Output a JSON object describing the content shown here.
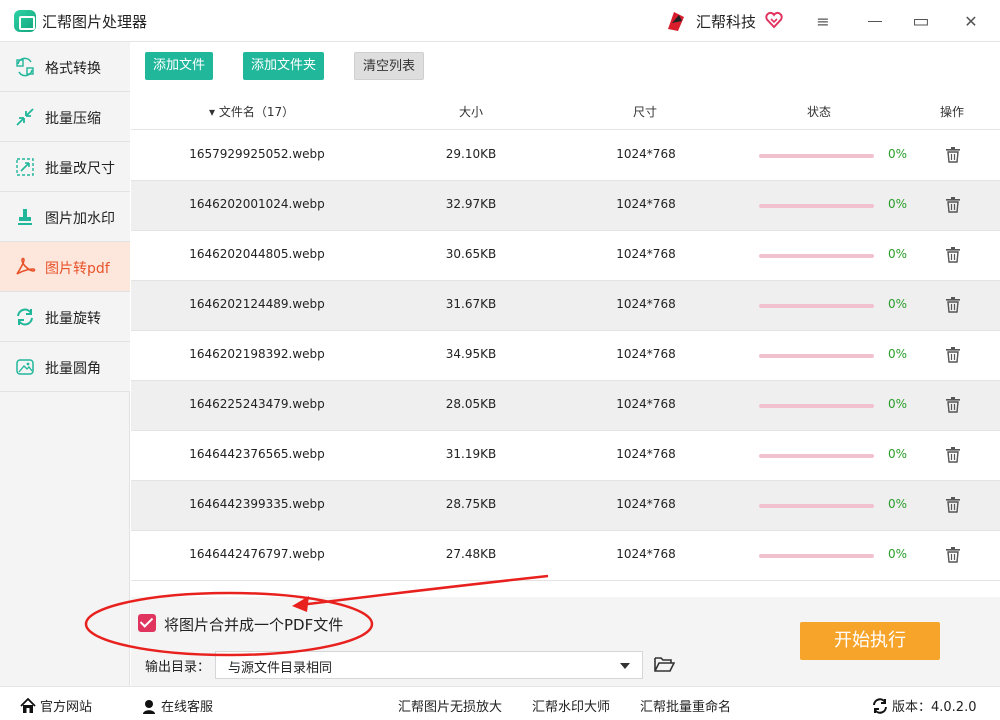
{
  "titlebar": {
    "app_title": "汇帮图片处理器",
    "brand_name": "汇帮科技",
    "menu_glyph": "≡",
    "maximize_glyph": "▭",
    "close_glyph": "✕"
  },
  "sidebar": {
    "items": [
      {
        "label": "格式转换",
        "icon": "format-convert-icon"
      },
      {
        "label": "批量压缩",
        "icon": "compress-icon"
      },
      {
        "label": "批量改尺寸",
        "icon": "resize-icon"
      },
      {
        "label": "图片加水印",
        "icon": "watermark-icon"
      },
      {
        "label": "图片转pdf",
        "icon": "pdf-icon",
        "active": true
      },
      {
        "label": "批量旋转",
        "icon": "rotate-icon"
      },
      {
        "label": "批量圆角",
        "icon": "round-corner-icon"
      }
    ]
  },
  "toolbar": {
    "add_file": "添加文件",
    "add_folder": "添加文件夹",
    "clear_list": "清空列表"
  },
  "table": {
    "headers": {
      "name": "▾ 文件名（17）",
      "size": "大小",
      "dimension": "尺寸",
      "status": "状态",
      "action": "操作"
    },
    "rows": [
      {
        "name": "1657929925052.webp",
        "size": "29.10KB",
        "dim": "1024*768",
        "progress": 0,
        "pct": "0%"
      },
      {
        "name": "1646202001024.webp",
        "size": "32.97KB",
        "dim": "1024*768",
        "progress": 0,
        "pct": "0%"
      },
      {
        "name": "1646202044805.webp",
        "size": "30.65KB",
        "dim": "1024*768",
        "progress": 0,
        "pct": "0%"
      },
      {
        "name": "1646202124489.webp",
        "size": "31.67KB",
        "dim": "1024*768",
        "progress": 0,
        "pct": "0%"
      },
      {
        "name": "1646202198392.webp",
        "size": "34.95KB",
        "dim": "1024*768",
        "progress": 0,
        "pct": "0%"
      },
      {
        "name": "1646225243479.webp",
        "size": "28.05KB",
        "dim": "1024*768",
        "progress": 0,
        "pct": "0%"
      },
      {
        "name": "1646442376565.webp",
        "size": "31.19KB",
        "dim": "1024*768",
        "progress": 0,
        "pct": "0%"
      },
      {
        "name": "1646442399335.webp",
        "size": "28.75KB",
        "dim": "1024*768",
        "progress": 0,
        "pct": "0%"
      },
      {
        "name": "1646442476797.webp",
        "size": "27.48KB",
        "dim": "1024*768",
        "progress": 0,
        "pct": "0%"
      }
    ]
  },
  "options": {
    "merge_checked": true,
    "merge_label": "将图片合并成一个PDF文件",
    "output_label": "输出目录：",
    "output_value": "与源文件目录相同",
    "start_button": "开始执行"
  },
  "footer": {
    "website": "官方网站",
    "support": "在线客服",
    "lossless": "汇帮图片无损放大",
    "watermark_master": "汇帮水印大师",
    "batch_rename": "汇帮批量重命名",
    "version": "版本：4.0.2.0"
  },
  "colors": {
    "accent_green": "#21b79b",
    "active_orange": "#e8542a",
    "start_orange": "#f7a42b",
    "annotation_red": "#e8211e"
  }
}
